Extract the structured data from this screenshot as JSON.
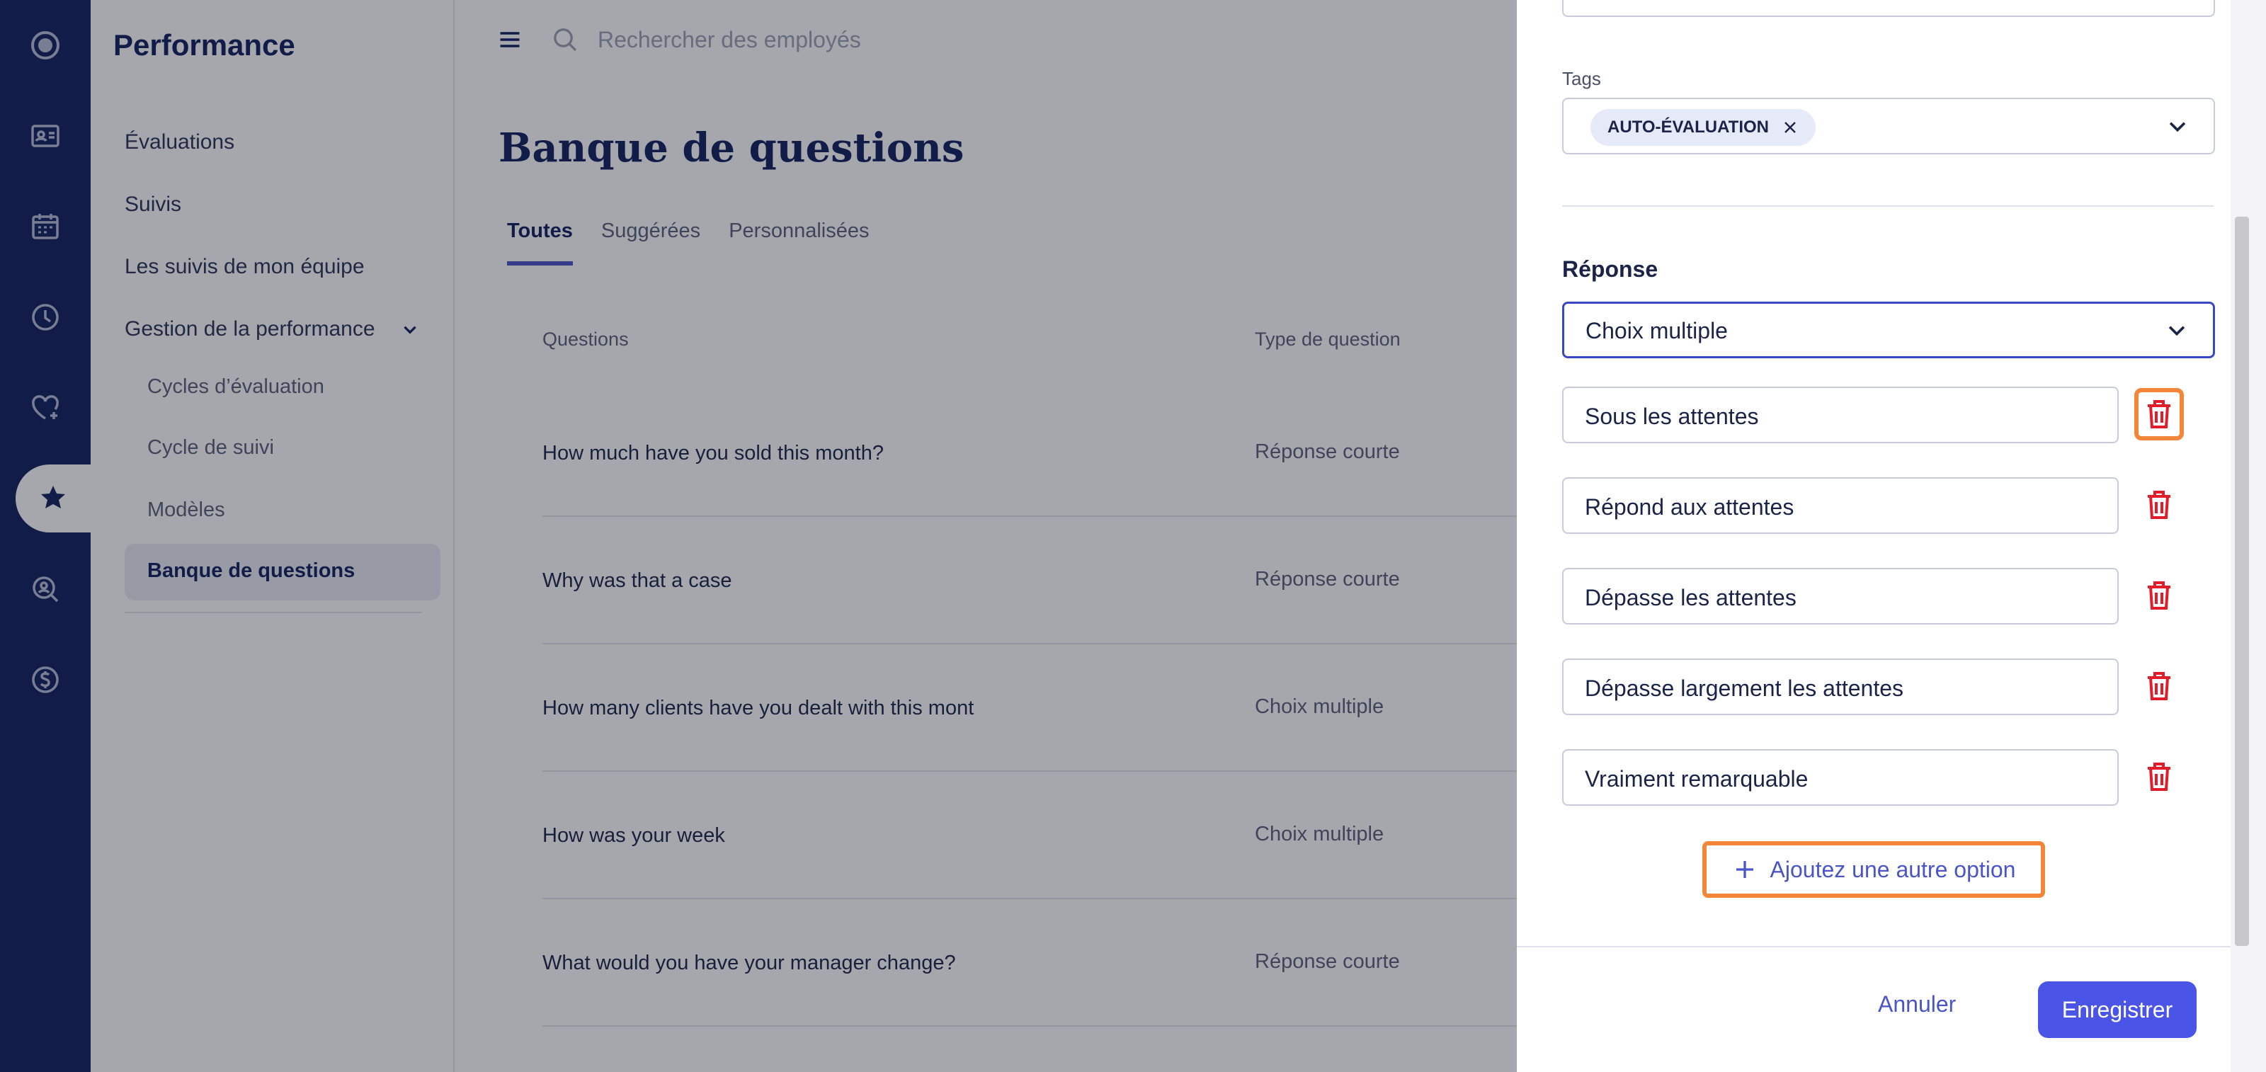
{
  "rail": {
    "items": [
      {
        "name": "logo",
        "icon": "logo-icon"
      },
      {
        "name": "employees",
        "icon": "id-card-icon"
      },
      {
        "name": "calendar",
        "icon": "calendar-icon"
      },
      {
        "name": "time",
        "icon": "clock-icon"
      },
      {
        "name": "wellbeing",
        "icon": "heart-plus-icon"
      },
      {
        "name": "performance",
        "icon": "star-badge-icon",
        "active": true
      },
      {
        "name": "recruiting",
        "icon": "search-person-icon"
      },
      {
        "name": "payroll",
        "icon": "dollar-icon"
      }
    ]
  },
  "sidebar": {
    "title": "Performance",
    "items": [
      {
        "label": "Évaluations"
      },
      {
        "label": "Suivis"
      },
      {
        "label": "Les suivis de mon équipe"
      },
      {
        "label": "Gestion de la performance"
      }
    ],
    "subitems": [
      {
        "label": "Cycles d’évaluation"
      },
      {
        "label": "Cycle de suivi"
      },
      {
        "label": "Modèles"
      },
      {
        "label": "Banque de questions",
        "selected": true
      }
    ]
  },
  "header": {
    "search_placeholder": "Rechercher des employés"
  },
  "main": {
    "title": "Banque de questions",
    "tabs": [
      {
        "label": "Toutes",
        "active": true
      },
      {
        "label": "Suggérées"
      },
      {
        "label": "Personnalisées"
      }
    ],
    "table": {
      "columns": [
        "Questions",
        "Type de question"
      ],
      "rows": [
        {
          "question": "How much have you sold this month?",
          "type": "Réponse courte"
        },
        {
          "question": "Why was that a case",
          "type": "Réponse courte"
        },
        {
          "question": "How many clients have you dealt with this mont",
          "type": "Choix multiple"
        },
        {
          "question": "How was your week",
          "type": "Choix multiple"
        },
        {
          "question": "What would you have your manager change?",
          "type": "Réponse courte"
        }
      ]
    }
  },
  "drawer": {
    "tags_label": "Tags",
    "tags": [
      "AUTO-ÉVALUATION"
    ],
    "response_title": "Réponse",
    "response_type": "Choix multiple",
    "options": [
      "Sous les attentes",
      "Répond aux attentes",
      "Dépasse les attentes",
      "Dépasse largement les attentes",
      "Vraiment remarquable"
    ],
    "add_option_label": "Ajoutez une autre option",
    "cancel_label": "Annuler",
    "save_label": "Enregistrer"
  },
  "colors": {
    "rail": "#10205e",
    "accent": "#4a55e8",
    "delete": "#e11d2a",
    "highlight": "#f2873a"
  }
}
